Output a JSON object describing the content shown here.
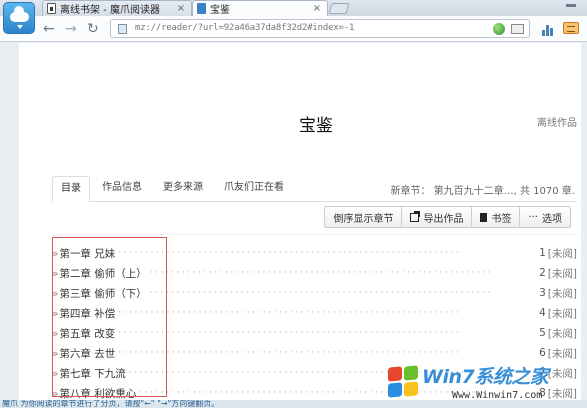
{
  "browser": {
    "tabs": [
      {
        "label": "离线书架 - 魔爪阅读器",
        "close": "×"
      },
      {
        "label": "宝鉴",
        "close": "×"
      }
    ],
    "address": "mz://reader/?url=92a46a37da8f32d2#index=-1",
    "nav": {
      "back": "←",
      "forward": "→",
      "reload": "↻"
    },
    "icons": [
      "app-logo-cloud-icon",
      "back-arrow-icon",
      "forward-arrow-icon",
      "reload-icon",
      "page-icon",
      "globe-icon",
      "reader-mode-icon",
      "chart-icon",
      "menu-icon"
    ]
  },
  "book": {
    "title": "宝鉴",
    "offline_label": "离线作品",
    "tabs": [
      "目录",
      "作品信息",
      "更多来源",
      "爪友们正在看"
    ],
    "new_chapter": "新章节：  第九百九十二章…, 共 1070 章."
  },
  "actions": [
    {
      "label": "倒序显示章节",
      "icon": ""
    },
    {
      "label": "导出作品",
      "icon": "export-icon"
    },
    {
      "label": "书签",
      "icon": "bookmark-icon"
    },
    {
      "label": "选项",
      "icon": "more-dots-icon",
      "glyph": "···"
    }
  ],
  "chapters": [
    {
      "title": "第一章 兄妹",
      "num": "1",
      "status": "[未阅]"
    },
    {
      "title": "第二章 偷师（上）",
      "num": "2",
      "status": "[未阅]"
    },
    {
      "title": "第三章 偷师（下）",
      "num": "3",
      "status": "[未阅]"
    },
    {
      "title": "第四章 补偿",
      "num": "4",
      "status": "[未阅]"
    },
    {
      "title": "第五章 改变",
      "num": "5",
      "status": "[未阅]"
    },
    {
      "title": "第六章 去世",
      "num": "6",
      "status": "[未阅]"
    },
    {
      "title": "第七章 下九流",
      "num": "7",
      "status": "[未阅]"
    },
    {
      "title": "第八章 利欲熏心",
      "num": "8",
      "status": "[未阅]"
    }
  ],
  "chapter_marker": "»",
  "leader": "································································",
  "status_bar": "魔爪 为你阅读的章节进行了分页，请按\"←\" \"→\"方向键翻页。",
  "watermark": {
    "main": "Win7系统之家",
    "sub": "Www.Winwin7.com"
  },
  "colors": {
    "accent": "#3b82c4",
    "highlight_box": "#d65656",
    "watermark": "#3a8fd6"
  }
}
